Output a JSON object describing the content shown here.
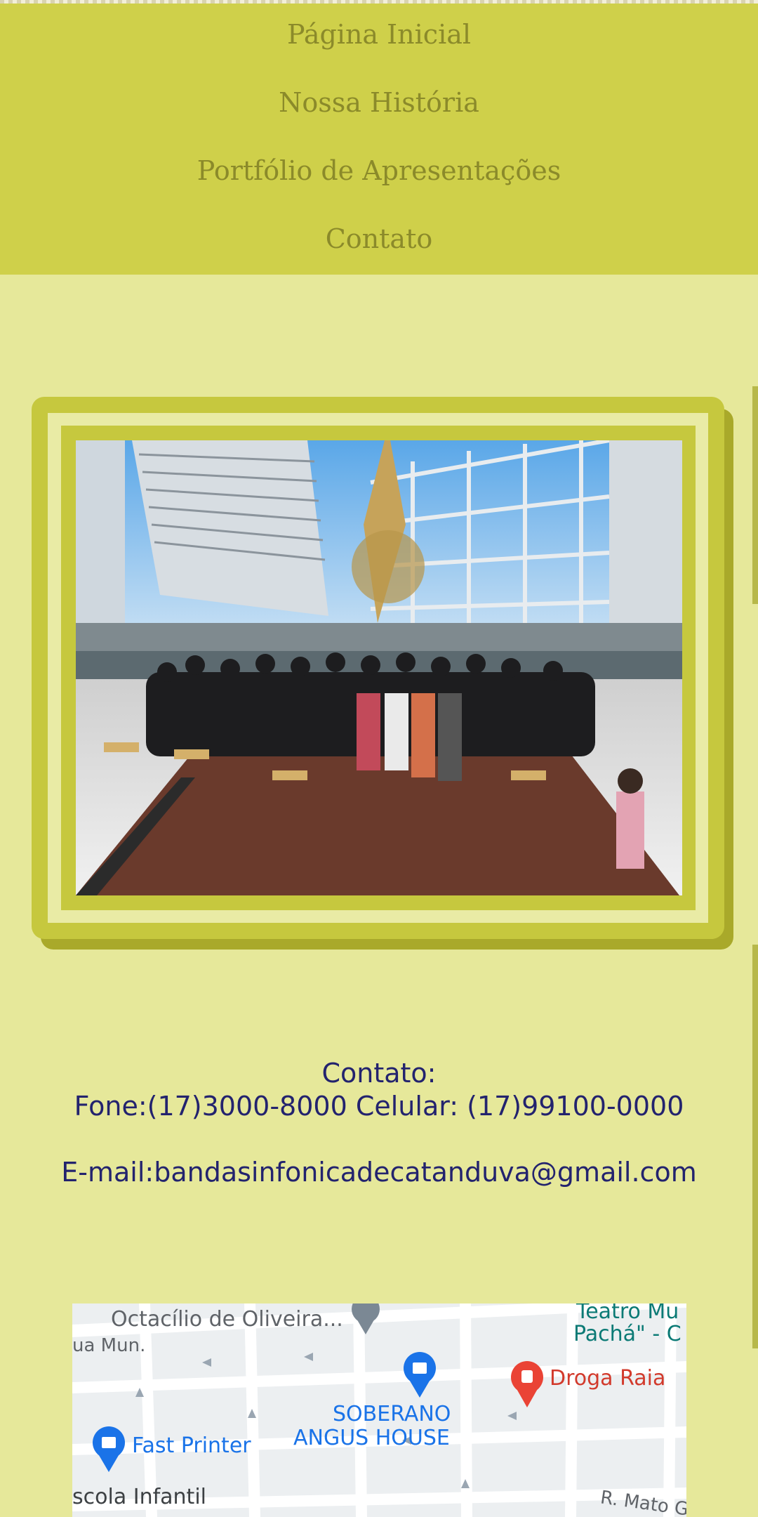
{
  "nav": {
    "items": [
      {
        "label": "Página Inicial"
      },
      {
        "label": "Nossa História"
      },
      {
        "label": "Portfólio de Apresentações"
      },
      {
        "label": "Contato"
      }
    ]
  },
  "contact": {
    "heading": "Contato:",
    "phones": "Fone:(17)3000-8000 Celular: (17)99100-0000",
    "email": "E-mail:bandasinfonicadecatanduva@gmail.com"
  },
  "map": {
    "labels": {
      "octacilio": "Octacílio de Oliveira...",
      "rua_mun": "ua Mun.",
      "teatro_1": "Teatro Mu",
      "teatro_2": "Pachá\" - C",
      "droga_raia": "Droga Raia",
      "soberano_1": "SOBERANO",
      "soberano_2": "ANGUS HOUSE",
      "fast_printer": "Fast Printer",
      "escola": "scola Infantil",
      "rua_mato": "R. Mato G"
    }
  },
  "colors": {
    "nav_bg": "#cfd04a",
    "nav_text": "#8b8a2a",
    "page_bg": "#e6e89a",
    "frame": "#c6c83e",
    "contact_text": "#23236e"
  }
}
